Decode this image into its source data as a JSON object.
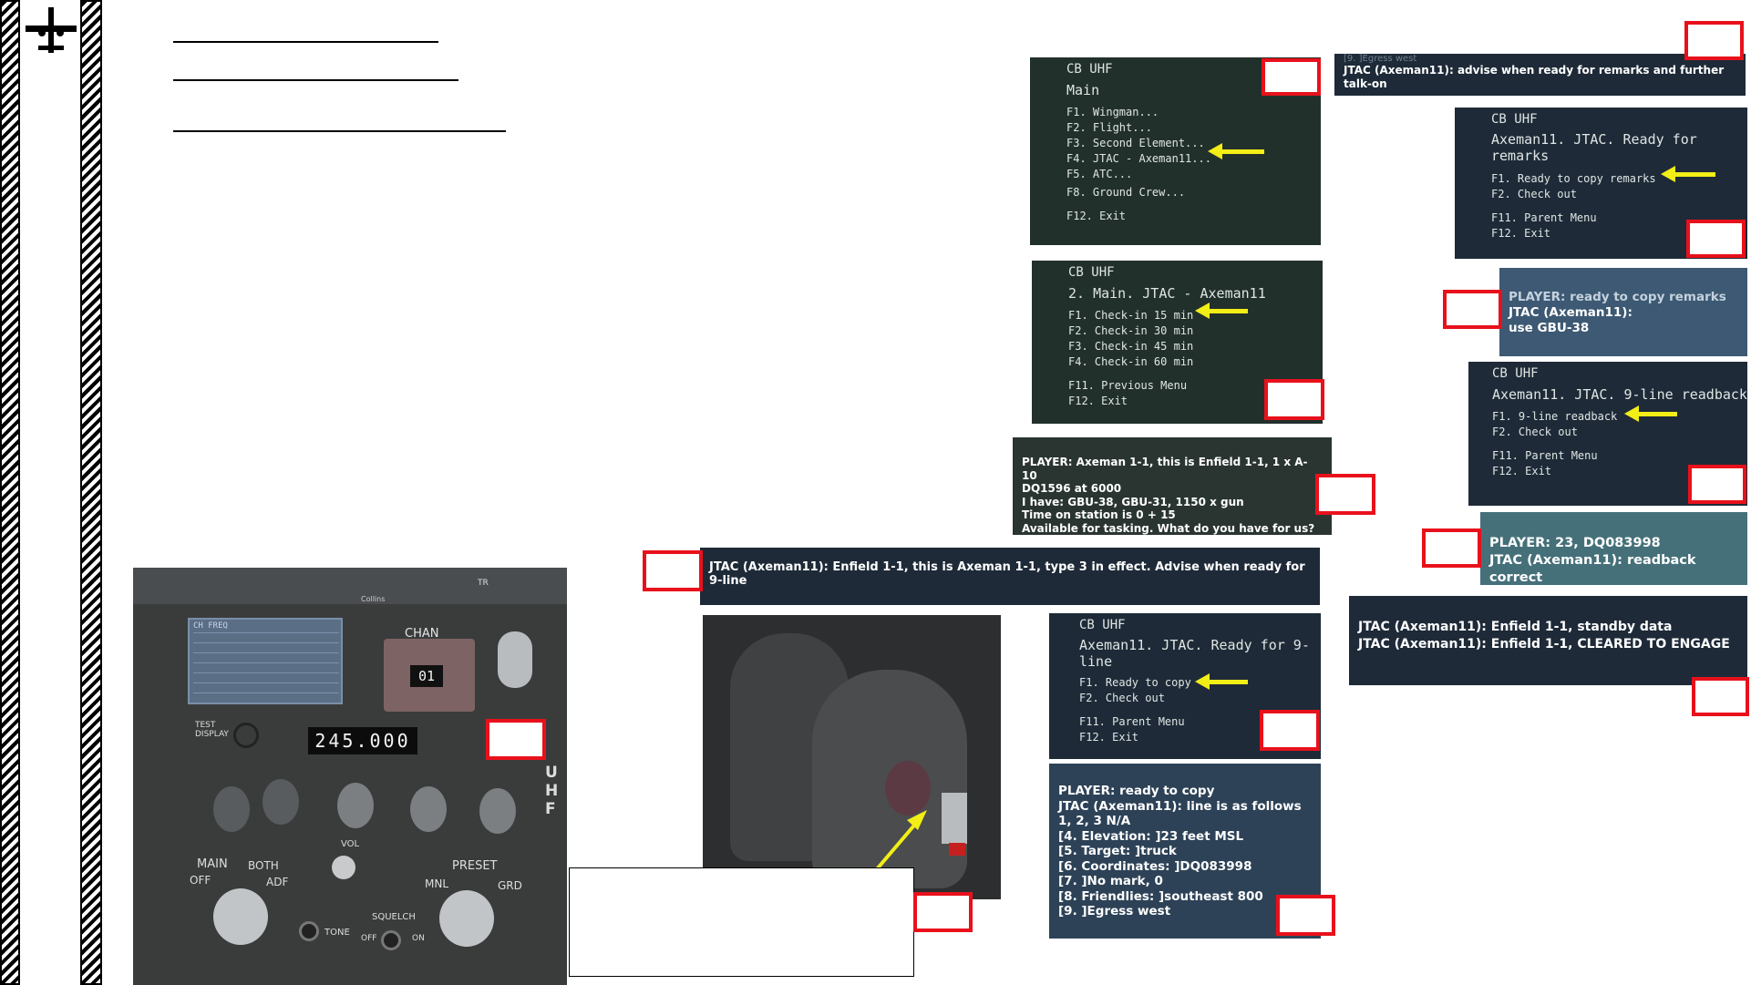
{
  "menu1": {
    "header": "CB UHF",
    "title": "Main",
    "items": [
      "F1. Wingman...",
      "F2. Flight...",
      "F3. Second Element...",
      "F4. JTAC - Axeman11...",
      "F5. ATC..."
    ],
    "items2": [
      "F8. Ground Crew..."
    ],
    "items3": [
      "F12. Exit"
    ]
  },
  "menu2": {
    "header": "CB UHF",
    "title": "2. Main. JTAC - Axeman11",
    "items": [
      "F1. Check-in 15 min",
      "F2. Check-in 30 min",
      "F3. Check-in 45 min",
      "F4. Check-in 60 min"
    ],
    "items2": [
      "F11. Previous Menu",
      "F12. Exit"
    ]
  },
  "msg_checkin": [
    "PLAYER: Axeman 1-1, this is Enfield 1-1, 1 x A-10",
    "DQ1596 at 6000",
    "I have: GBU-38, GBU-31, 1150 x gun",
    "Time on station is 0 + 15",
    "Available for tasking. What do you have for us?"
  ],
  "msg_type3": "JTAC (Axeman11): Enfield 1-1, this is Axeman 1-1, type 3 in effect. Advise when ready for 9-line",
  "menu3": {
    "header": "CB UHF",
    "title": "Axeman11. JTAC. Ready for 9-line",
    "items": [
      "F1. Ready to copy",
      "F2. Check out"
    ],
    "items2": [
      "F11. Parent Menu",
      "F12. Exit"
    ]
  },
  "msg_nineline": [
    "PLAYER: ready to copy",
    "JTAC (Axeman11): line is as follows",
    "1, 2, 3 N/A",
    "[4. Elevation: ]23 feet MSL",
    "[5. Target: ]truck",
    "[6. Coordinates: ]DQ083998",
    "[7. ]No mark, 0",
    "[8. Friendlies: ]southeast 800",
    "[9. ]Egress west"
  ],
  "msg_advise": {
    "faint": "[9. ]Egress west",
    "text": "JTAC (Axeman11): advise when ready for remarks and further talk-on"
  },
  "menu4": {
    "header": "CB UHF",
    "title": "Axeman11. JTAC. Ready for remarks",
    "items": [
      "F1. Ready to copy remarks",
      "F2. Check out"
    ],
    "items2": [
      "F11. Parent Menu",
      "F12. Exit"
    ]
  },
  "msg_remarks": {
    "line1": "PLAYER: ready to copy remarks",
    "line2": "JTAC (Axeman11):",
    "line3": "use GBU-38"
  },
  "menu5": {
    "header": "CB UHF",
    "title": "Axeman11. JTAC. 9-line readback",
    "items": [
      "F1. 9-line readback",
      "F2. Check out"
    ],
    "items2": [
      "F11. Parent Menu",
      "F12. Exit"
    ]
  },
  "msg_readback": [
    "PLAYER: 23, DQ083998",
    "JTAC (Axeman11): readback correct"
  ],
  "msg_cleared": [
    "JTAC (Axeman11): Enfield 1-1, standby data",
    "JTAC (Axeman11): Enfield 1-1, CLEARED TO ENGAGE"
  ],
  "radio_panel": {
    "chan_label": "CHAN",
    "chan_value": "01",
    "freq_value": "245.000",
    "test_display": "TEST DISPLAY",
    "vol": "VOL",
    "main": "MAIN",
    "off": "OFF",
    "both": "BOTH",
    "adf": "ADF",
    "preset": "PRESET",
    "mnl": "MNL",
    "grd": "GRD",
    "squelch": "SQUELCH",
    "tone": "TONE",
    "on": "ON",
    "uhf_side": "UHF",
    "tr": "TR",
    "freq_table_head": "CH  FREQ",
    "collins": "Collins"
  },
  "colors": {
    "marker_red": "#e8111b",
    "arrow_yellow": "#f2ee16",
    "menu_green": "#22302c",
    "menu_blue": "#1e2a38"
  }
}
